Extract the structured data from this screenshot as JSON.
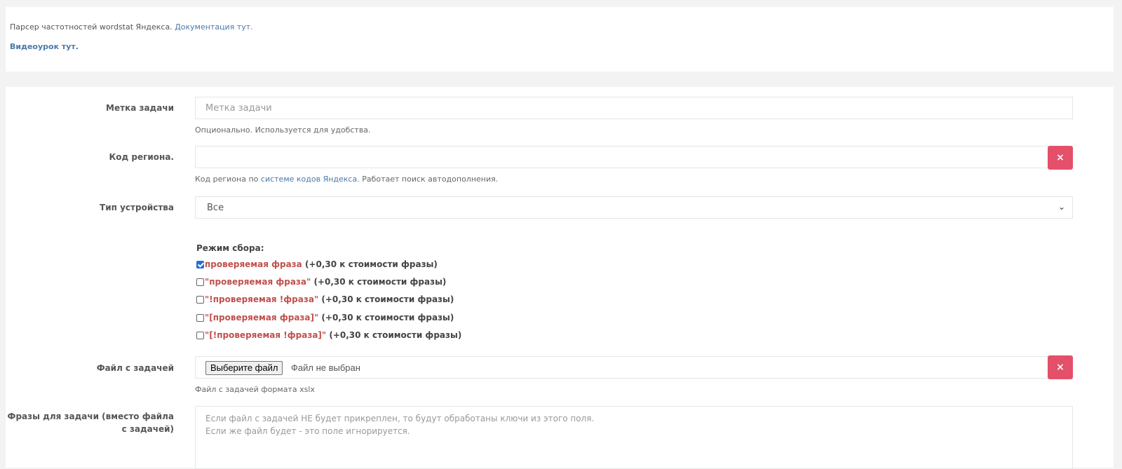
{
  "info": {
    "text": "Парсер частотностей wordstat Яндекса.",
    "doc_link": "Документация тут.",
    "video_link": "Видеоурок тут."
  },
  "form": {
    "task_label": {
      "label": "Метка задачи",
      "placeholder": "Метка задачи",
      "help": "Опционально. Используется для удобства."
    },
    "region": {
      "label": "Код региона.",
      "value": "",
      "help_prefix": "Код региона по",
      "help_link": "системе кодов Яндекса.",
      "help_suffix": "Работает поиск автодополнения.",
      "clear_icon": "×"
    },
    "device": {
      "label": "Тип устройства",
      "selected": "Все"
    },
    "mode": {
      "title": "Режим сбора:",
      "options": [
        {
          "phrase": "проверяемая фраза",
          "cost": "(+0,30 к стоимости фразы)",
          "checked": true
        },
        {
          "phrase": "\"проверяемая фраза\"",
          "cost": "(+0,30 к стоимости фразы)",
          "checked": false
        },
        {
          "phrase": "\"!проверяемая !фраза\"",
          "cost": "(+0,30 к стоимости фразы)",
          "checked": false
        },
        {
          "phrase": "\"[проверяемая фраза]\"",
          "cost": "(+0,30 к стоимости фразы)",
          "checked": false
        },
        {
          "phrase": "\"[!проверяемая !фраза]\"",
          "cost": "(+0,30 к стоимости фразы)",
          "checked": false
        }
      ]
    },
    "file": {
      "label": "Файл с задачей",
      "button": "Выберите файл",
      "status": "Файл не выбран",
      "help": "Файл с задачей формата xslx",
      "clear_icon": "×"
    },
    "phrases": {
      "label_line1": "Фразы для задачи (вместо файла",
      "label_line2": "с задачей)",
      "placeholder_line1": "Если файл с задачей НЕ будет прикреплен, то будут обработаны ключи из этого поля.",
      "placeholder_line2": "Если же файл будет - это поле игнорируется."
    }
  }
}
